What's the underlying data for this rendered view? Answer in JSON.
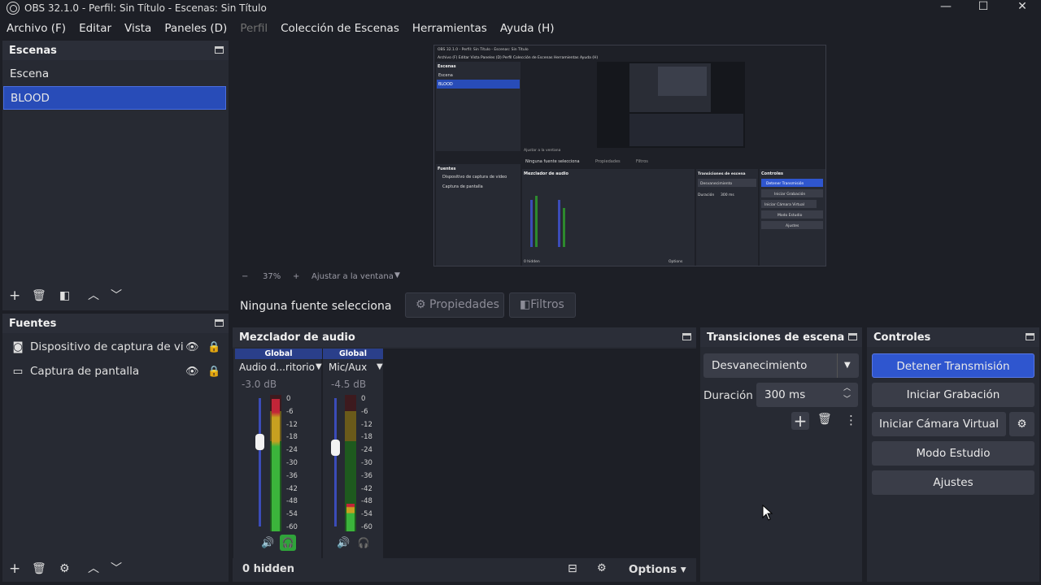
{
  "window": {
    "title": "OBS 32.1.0 - Perfil: Sin Título - Escenas: Sin Título",
    "min": "—",
    "max": "☐",
    "close": "✕"
  },
  "menu": {
    "archivo": "Archivo (F)",
    "editar": "Editar",
    "vista": "Vista",
    "paneles": "Paneles (D)",
    "perfil": "Perfil",
    "coleccion": "Colección de Escenas",
    "herramientas": "Herramientas",
    "ayuda": "Ayuda (H)"
  },
  "scenes": {
    "title": "Escenas",
    "items": [
      "Escena",
      "BLOOD"
    ],
    "selected_index": 1
  },
  "sources": {
    "title": "Fuentes",
    "items": [
      {
        "label": "Dispositivo de captura de video",
        "icon": "camera-icon"
      },
      {
        "label": "Captura de pantalla",
        "icon": "monitor-icon"
      }
    ]
  },
  "preview": {
    "zoom": "37%",
    "zoom_minus": "−",
    "zoom_plus": "+",
    "fit": "Ajustar a la ventana"
  },
  "source_toolbar": {
    "status": "Ninguna fuente selecciona",
    "properties": "Propiedades",
    "filters": "Filtros"
  },
  "audio_mixer": {
    "title": "Mezclador de audio",
    "tracks": [
      {
        "tag": "Global",
        "name": "Audio d...ritorio",
        "db": "-3.0 dB",
        "volume_fraction": 0.82,
        "level_fraction": 0.97,
        "headphone_active": true
      },
      {
        "tag": "Global",
        "name": "Mic/Aux",
        "db": "-4.5 dB",
        "volume_fraction": 0.78,
        "level_fraction": 0.2,
        "headphone_active": false
      }
    ],
    "scale": [
      "0",
      "-6",
      "-12",
      "-18",
      "-24",
      "-30",
      "-36",
      "-42",
      "-48",
      "-54",
      "-60"
    ],
    "hidden_label": "0 hidden",
    "options_label": "Options"
  },
  "transitions": {
    "title": "Transiciones de escena",
    "selected": "Desvanecimiento",
    "duration_label": "Duración",
    "duration_value": "300 ms"
  },
  "controls": {
    "title": "Controles",
    "stop_stream": "Detener Transmisión",
    "start_recording": "Iniciar Grabación",
    "virtual_camera": "Iniciar Cámara Virtual",
    "studio_mode": "Modo Estudio",
    "settings": "Ajustes"
  },
  "nested_preview": {
    "title": "OBS 32.1.0 - Perfil: Sin Título - Escenas: Sin Título",
    "menu": "Archivo (F)  Editar  Vista  Paneles (D)  Perfil  Colección de Escenas  Herramientas  Ayuda (H)",
    "scenes_title": "Escenas",
    "scene1": "Escena",
    "scene2": "BLOOD",
    "sources_title": "Fuentes",
    "source1": "Dispositivo de captura de video",
    "source2": "Captura de pantalla",
    "status": "Ninguna fuente selecciona",
    "properties": "Propiedades",
    "filters": "Filtros",
    "mixer": "Mezclador de audio",
    "transitions": "Transiciones de escena",
    "controls": "Controles",
    "fade": "Desvanecimiento",
    "duration": "Duración",
    "duration_value": "300 ms",
    "btn1": "Detener Transmisión",
    "btn2": "Iniciar Grabación",
    "btn3": "Iniciar Cámara Virtual",
    "btn4": "Modo Estudio",
    "btn5": "Ajustes",
    "hidden": "0 hidden",
    "options": "Options",
    "fit": "Ajustar a la ventana",
    "zoom": "37%"
  },
  "colors": {
    "accent": "#284cb8",
    "panel": "#272a33",
    "background": "#1d1f26"
  }
}
